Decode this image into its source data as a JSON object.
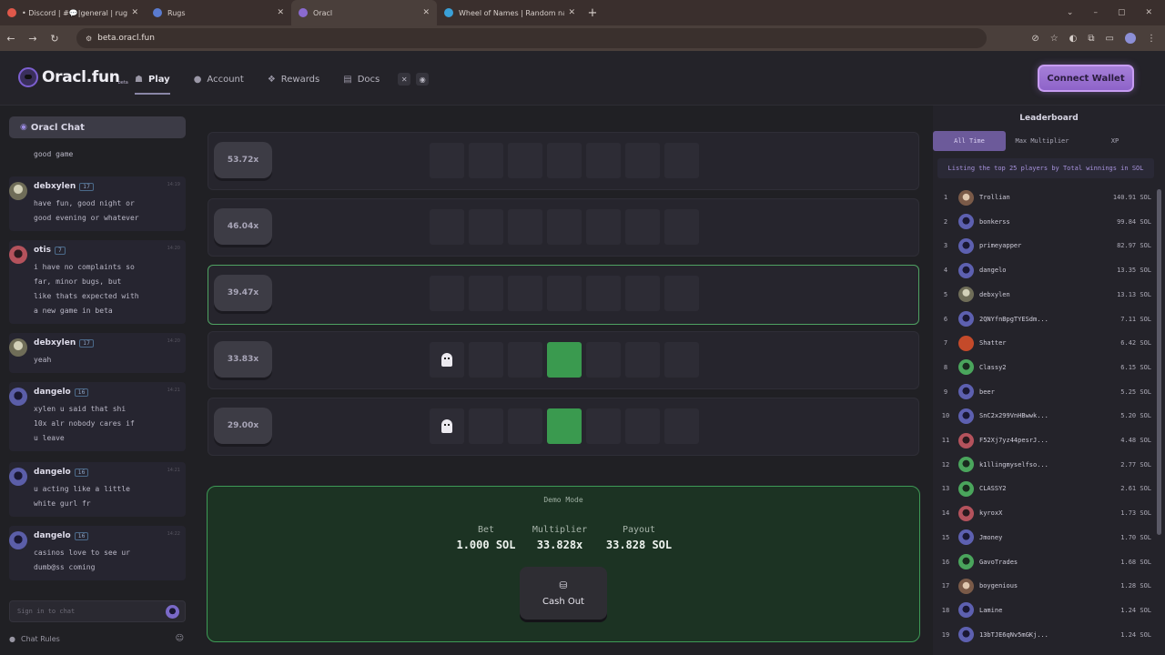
{
  "browser": {
    "tabs": [
      {
        "title": "• Discord | #💬|general | rugs.",
        "active": false,
        "favicon_color": "#e0584a"
      },
      {
        "title": "Rugs",
        "active": false,
        "favicon_color": "#5a7bd0"
      },
      {
        "title": "Oracl",
        "active": true,
        "favicon_color": "#8a6ad0"
      },
      {
        "title": "Wheel of Names | Random nam",
        "active": false,
        "favicon_color": "#3aa0d8"
      }
    ],
    "url": "beta.oracl.fun"
  },
  "header": {
    "logo_text": "Oracl.fun",
    "logo_tag": "beta",
    "nav": [
      {
        "label": "Play",
        "icon": "ghost-icon",
        "active": true
      },
      {
        "label": "Account",
        "icon": "user-icon",
        "active": false
      },
      {
        "label": "Rewards",
        "icon": "gift-icon",
        "active": false
      },
      {
        "label": "Docs",
        "icon": "document-icon",
        "active": false
      }
    ],
    "connect_label": "Connect Wallet"
  },
  "chat": {
    "title": "Oracl Chat",
    "partial_message": "good game",
    "messages": [
      {
        "user": "debxylen",
        "level": "17",
        "avatar": "olive",
        "time": "14:19",
        "text": "have fun, good night or\ngood evening or whatever"
      },
      {
        "user": "otis",
        "level": "7",
        "avatar": "red",
        "time": "14:20",
        "text": "i have no complaints so\nfar, minor bugs, but\nlike thats expected with\na new game in beta"
      },
      {
        "user": "debxylen",
        "level": "17",
        "avatar": "olive",
        "time": "14:20",
        "text": "yeah"
      },
      {
        "user": "dangelo",
        "level": "16",
        "avatar": "purple",
        "time": "14:21",
        "text": "xylen u said that shi\n10x alr nobody cares if\nu leave"
      },
      {
        "user": "dangelo",
        "level": "16",
        "avatar": "purple",
        "time": "14:21",
        "text": "u acting like a little\nwhite gurl fr"
      },
      {
        "user": "dangelo",
        "level": "16",
        "avatar": "purple",
        "time": "14:22",
        "text": "casinos love to see ur\ndumb@ss coming"
      }
    ],
    "input_placeholder": "Sign in to chat",
    "rules_label": "Chat Rules"
  },
  "game": {
    "rows": [
      {
        "multiplier": "53.72x",
        "highlight": false,
        "ghost_index": -1,
        "green_index": -1
      },
      {
        "multiplier": "46.04x",
        "highlight": false,
        "ghost_index": -1,
        "green_index": -1
      },
      {
        "multiplier": "39.47x",
        "highlight": true,
        "ghost_index": -1,
        "green_index": -1
      },
      {
        "multiplier": "33.83x",
        "highlight": false,
        "ghost_index": 0,
        "green_index": 3
      },
      {
        "multiplier": "29.00x",
        "highlight": false,
        "ghost_index": 0,
        "green_index": 3
      }
    ],
    "tiles_per_row": 7,
    "mode_label": "Demo Mode",
    "bet_label": "Bet",
    "bet_value": "1.000 SOL",
    "multiplier_label": "Multiplier",
    "multiplier_value": "33.828x",
    "payout_label": "Payout",
    "payout_value": "33.828 SOL",
    "cashout_label": "Cash Out"
  },
  "leaderboard": {
    "title": "Leaderboard",
    "tabs": [
      "All Time",
      "Max Multiplier",
      "XP"
    ],
    "active_tab": "All Time",
    "note": "Listing the top 25 players by Total winnings in SOL",
    "entries": [
      {
        "rank": "1",
        "name": "Trollian",
        "amount": "140.91 SOL",
        "avatar": "brown"
      },
      {
        "rank": "2",
        "name": "bonkerss",
        "amount": "99.84 SOL",
        "avatar": "purple"
      },
      {
        "rank": "3",
        "name": "primeyapper",
        "amount": "82.97 SOL",
        "avatar": "purple"
      },
      {
        "rank": "4",
        "name": "dangelo",
        "amount": "13.35 SOL",
        "avatar": "purple"
      },
      {
        "rank": "5",
        "name": "debxylen",
        "amount": "13.13 SOL",
        "avatar": "olive"
      },
      {
        "rank": "6",
        "name": "2QNYfnBpgTYESdm...",
        "amount": "7.11 SOL",
        "avatar": "purple"
      },
      {
        "rank": "7",
        "name": "Shatter",
        "amount": "6.42 SOL",
        "avatar": "orange"
      },
      {
        "rank": "8",
        "name": "Classy2",
        "amount": "6.15 SOL",
        "avatar": "green"
      },
      {
        "rank": "9",
        "name": "beer",
        "amount": "5.25 SOL",
        "avatar": "purple"
      },
      {
        "rank": "10",
        "name": "SnC2x299VnHBwwk...",
        "amount": "5.20 SOL",
        "avatar": "purple"
      },
      {
        "rank": "11",
        "name": "F52Xj7yz44pesrJ...",
        "amount": "4.48 SOL",
        "avatar": "red"
      },
      {
        "rank": "12",
        "name": "k1llingmyselfso...",
        "amount": "2.77 SOL",
        "avatar": "green"
      },
      {
        "rank": "13",
        "name": "CLASSY2",
        "amount": "2.61 SOL",
        "avatar": "green"
      },
      {
        "rank": "14",
        "name": "kyroxX",
        "amount": "1.73 SOL",
        "avatar": "red"
      },
      {
        "rank": "15",
        "name": "Jmoney",
        "amount": "1.70 SOL",
        "avatar": "purple"
      },
      {
        "rank": "16",
        "name": "GavoTrades",
        "amount": "1.68 SOL",
        "avatar": "green"
      },
      {
        "rank": "17",
        "name": "boygenious",
        "amount": "1.28 SOL",
        "avatar": "brown"
      },
      {
        "rank": "18",
        "name": "Lamine",
        "amount": "1.24 SOL",
        "avatar": "purple"
      },
      {
        "rank": "19",
        "name": "13bTJE6qNv5mGKj...",
        "amount": "1.24 SOL",
        "avatar": "purple"
      }
    ]
  }
}
